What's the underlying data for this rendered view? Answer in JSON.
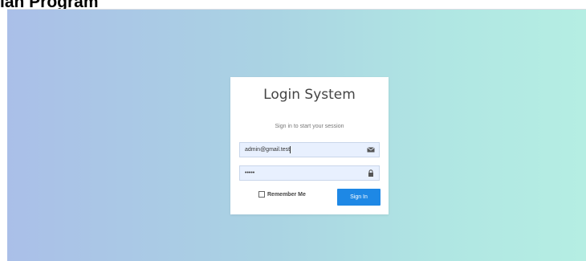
{
  "document": {
    "heading_fragment": "ian Program"
  },
  "login": {
    "title": "Login System",
    "subtitle": "Sign in to start your session",
    "email_value": "admin@gmail.test",
    "password_mask": "•••••",
    "email_icon": "envelope-icon",
    "password_icon": "lock-icon",
    "remember_label": "Remember Me",
    "remember_checked": false,
    "signin_label": "Sign In"
  },
  "colors": {
    "gradient_left": "#aabfe8",
    "gradient_right": "#b5eee3",
    "button": "#1e88e5",
    "input_bg": "#e8f0fe"
  }
}
